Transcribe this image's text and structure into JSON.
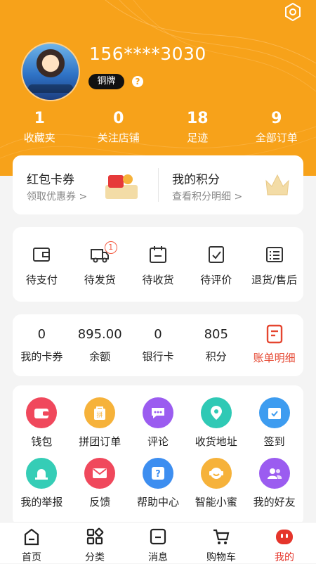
{
  "profile": {
    "phone": "156****3030",
    "level_badge": "铜牌",
    "help_mark": "?"
  },
  "stats": [
    {
      "value": "1",
      "label": "收藏夹"
    },
    {
      "value": "0",
      "label": "关注店铺"
    },
    {
      "value": "18",
      "label": "足迹"
    },
    {
      "value": "9",
      "label": "全部订单"
    }
  ],
  "promo": {
    "coupon": {
      "title": "红包卡券",
      "subtitle": "领取优惠券 >",
      "icon": "red-envelope-icon"
    },
    "points": {
      "title": "我的积分",
      "subtitle": "查看积分明细 >",
      "icon": "crown-icon"
    }
  },
  "orders": [
    {
      "label": "待支付",
      "icon": "wallet-outline-icon"
    },
    {
      "label": "待发货",
      "icon": "truck-icon",
      "badge": "1"
    },
    {
      "label": "待收货",
      "icon": "calendar-box-icon"
    },
    {
      "label": "待评价",
      "icon": "review-icon"
    },
    {
      "label": "退货/售后",
      "icon": "return-list-icon"
    }
  ],
  "wallet": [
    {
      "value": "0",
      "label": "我的卡券"
    },
    {
      "value": "895.00",
      "label": "余额"
    },
    {
      "value": "0",
      "label": "银行卡"
    },
    {
      "value": "805",
      "label": "积分"
    },
    {
      "label": "账单明细",
      "icon": "bill-icon"
    }
  ],
  "services": [
    {
      "label": "钱包",
      "icon": "wallet-icon",
      "color": "#f0485c"
    },
    {
      "label": "拼团订单",
      "icon": "group-bag-icon",
      "color": "#f6b23a"
    },
    {
      "label": "评论",
      "icon": "comment-icon",
      "color": "#9b5cf0"
    },
    {
      "label": "收货地址",
      "icon": "location-icon",
      "color": "#2fc9b5"
    },
    {
      "label": "签到",
      "icon": "checkin-icon",
      "color": "#3d9cf0"
    },
    {
      "label": "我的举报",
      "icon": "alarm-icon",
      "color": "#35cdb6"
    },
    {
      "label": "反馈",
      "icon": "mail-icon",
      "color": "#f0485c"
    },
    {
      "label": "帮助中心",
      "icon": "help-icon",
      "color": "#3d8ef0"
    },
    {
      "label": "智能小蜜",
      "icon": "assistant-icon",
      "color": "#f6b23a"
    },
    {
      "label": "我的好友",
      "icon": "friends-icon",
      "color": "#9b5cf0"
    }
  ],
  "tabs": [
    {
      "label": "首页",
      "icon": "home-icon"
    },
    {
      "label": "分类",
      "icon": "category-icon"
    },
    {
      "label": "消息",
      "icon": "message-icon"
    },
    {
      "label": "购物车",
      "icon": "cart-icon"
    },
    {
      "label": "我的",
      "icon": "profile-face-icon",
      "active": true
    }
  ],
  "colors": {
    "brand": "#f7a21a",
    "active": "#e5352b"
  }
}
